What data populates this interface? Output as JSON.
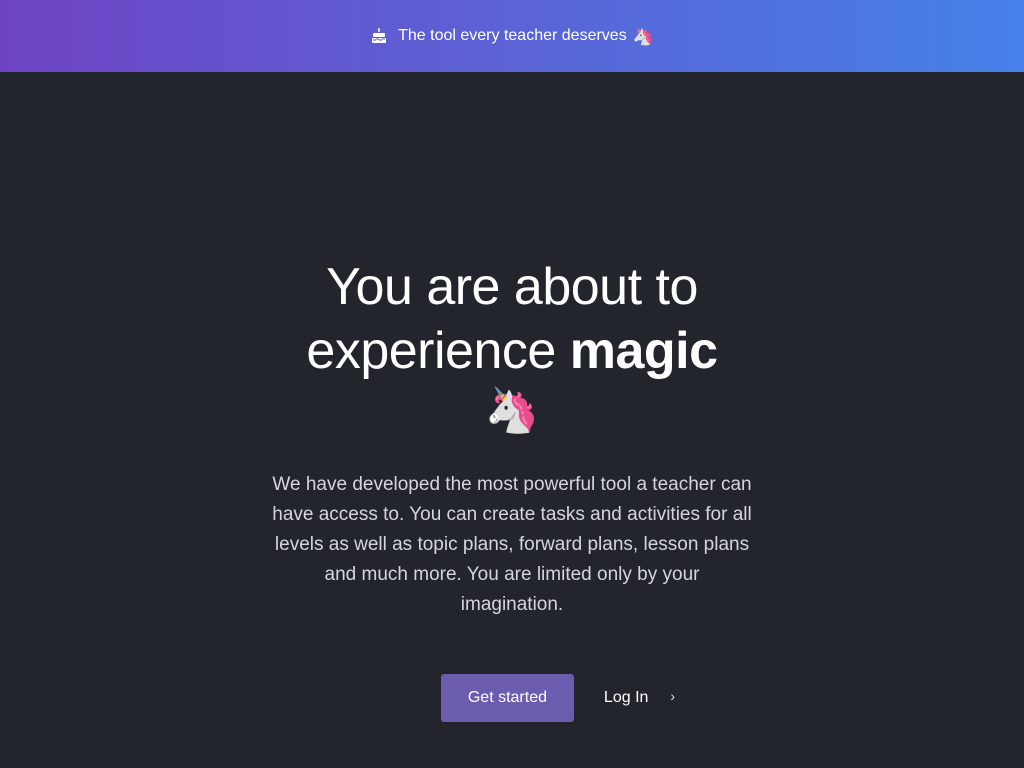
{
  "banner": {
    "icon": "cake-icon",
    "text": "The tool every teacher deserves",
    "emoji": "🦄"
  },
  "hero": {
    "headline_line1": "You are about to",
    "headline_line2_plain": "experience ",
    "headline_line2_bold": "magic",
    "headline_emoji": "🦄",
    "description": "We have developed the most powerful tool a teacher can have access to. You can create tasks and activities for all levels as well as topic plans, forward plans, lesson plans and much more. You are limited only by your imagination."
  },
  "cta": {
    "primary_label": "Get started",
    "secondary_label": "Log In",
    "secondary_icon": "chevron-right-icon"
  },
  "colors": {
    "background": "#22252b",
    "banner_gradient_start": "#6e44c4",
    "banner_gradient_end": "#4581e8",
    "primary_button": "#6b5cb0"
  }
}
